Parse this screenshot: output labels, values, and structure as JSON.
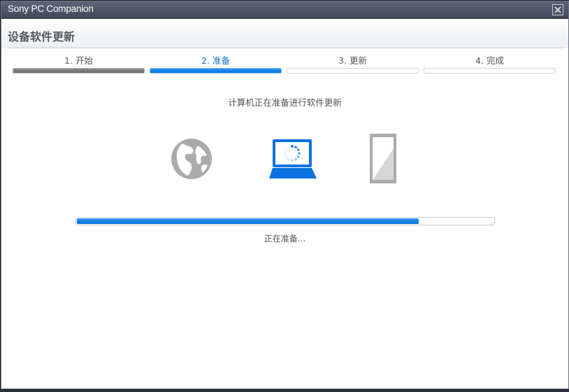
{
  "window": {
    "title": "Sony PC Companion",
    "close_icon": "close-icon"
  },
  "header": {
    "heading": "设备软件更新"
  },
  "steps": [
    {
      "label": "1. 开始",
      "state": "done"
    },
    {
      "label": "2. 准备",
      "state": "active"
    },
    {
      "label": "3. 更新",
      "state": "pending"
    },
    {
      "label": "4. 完成",
      "state": "pending"
    }
  ],
  "main": {
    "message": "计算机正在准备进行软件更新",
    "icons": [
      "globe-icon",
      "laptop-icon",
      "phone-icon"
    ],
    "progress_percent": 82,
    "status": "正在准备..."
  },
  "colors": {
    "accent": "#1273cf",
    "progress": "#0a72e0",
    "done": "#7a7a7a",
    "icon_gray": "#aaaaaa"
  }
}
